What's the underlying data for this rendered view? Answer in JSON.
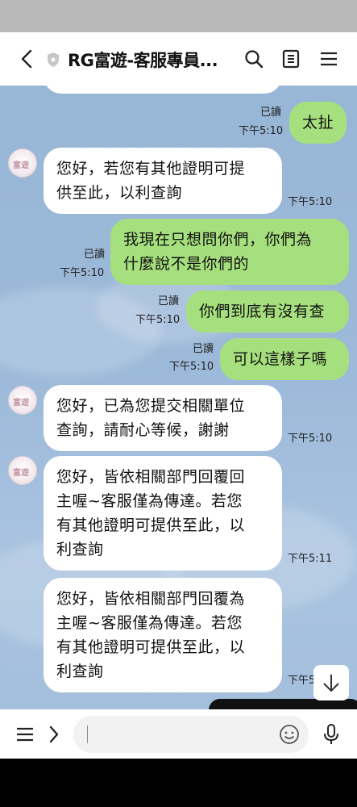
{
  "header": {
    "title": "RG富遊-客服專員...",
    "back_icon": "chevron-left-icon",
    "icons": [
      "search-icon",
      "notes-icon",
      "menu-icon"
    ]
  },
  "messages": [
    {
      "dir": "out",
      "lines": [
        "太扯"
      ],
      "read": "已讀",
      "time": "下午5:10"
    },
    {
      "dir": "in",
      "lines": [
        "您好，若您有其他證明可提",
        "供至此，以利查詢"
      ],
      "time": "下午5:10"
    },
    {
      "dir": "out",
      "lines": [
        "我現在只想問你們，你們為",
        "什麼說不是你們的"
      ],
      "read": "已讀",
      "time": "下午5:10"
    },
    {
      "dir": "out",
      "lines": [
        "你們到底有沒有查"
      ],
      "read": "已讀",
      "time": "下午5:10"
    },
    {
      "dir": "out",
      "lines": [
        "可以這樣子嗎"
      ],
      "read": "已讀",
      "time": "下午5:10"
    },
    {
      "dir": "in",
      "lines": [
        "您好，已為您提交相關單位",
        "查詢，請耐心等候，謝謝"
      ],
      "time": "下午5:10"
    },
    {
      "dir": "in",
      "lines": [
        "您好，皆依相關部門回覆回",
        "主喔~客服僅為傳達。若您",
        "有其他證明可提供至此，以",
        "利查詢"
      ],
      "time": "下午5:11"
    },
    {
      "dir": "in",
      "lines": [
        "您好，皆依相關部門回覆為",
        "主喔~客服僅為傳達。若您",
        "有其他證明可提供至此，以",
        "利查詢"
      ],
      "time": "下午5"
    }
  ],
  "avatar_text": "富遊",
  "input": {
    "placeholder": ""
  },
  "colors": {
    "chat_bg": "#9cb9d9",
    "out_bubble": "#a6e07e",
    "in_bubble": "#ffffff"
  }
}
